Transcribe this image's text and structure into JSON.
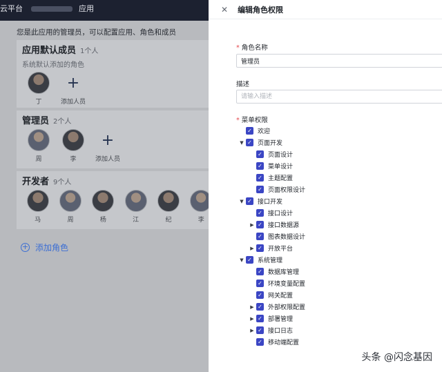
{
  "left": {
    "topbar_text": "云平台",
    "topbar_suffix": "应用",
    "intro": "您是此应用的管理员，可以配置应用、角色和成员",
    "default_members": {
      "title": "应用默认成员",
      "count": "1个人",
      "subtitle": "系统默认添加的角色",
      "members": [
        {
          "name": "丁"
        }
      ],
      "add_label": "添加人员"
    },
    "admins": {
      "title": "管理员",
      "count": "2个人",
      "members": [
        {
          "name": "周"
        },
        {
          "name": "李"
        }
      ],
      "add_label": "添加人员"
    },
    "developers": {
      "title": "开发者",
      "count": "9个人",
      "members": [
        {
          "name": "马"
        },
        {
          "name": "周"
        },
        {
          "name": "杨"
        },
        {
          "name": "江"
        },
        {
          "name": "纪"
        },
        {
          "name": "李"
        }
      ]
    },
    "add_role": "添加角色"
  },
  "drawer": {
    "title": "编辑角色权限",
    "role_name_label": "角色名称",
    "role_name_value": "管理员",
    "desc_label": "描述",
    "desc_placeholder": "请输入描述",
    "menu_label": "菜单权限",
    "tree": [
      {
        "label": "欢迎",
        "level": 0,
        "caret": "none"
      },
      {
        "label": "页面开发",
        "level": 0,
        "caret": "open"
      },
      {
        "label": "页面设计",
        "level": 1,
        "caret": "none"
      },
      {
        "label": "菜单设计",
        "level": 1,
        "caret": "none"
      },
      {
        "label": "主题配置",
        "level": 1,
        "caret": "none"
      },
      {
        "label": "页面权限设计",
        "level": 1,
        "caret": "none"
      },
      {
        "label": "接口开发",
        "level": 0,
        "caret": "open"
      },
      {
        "label": "接口设计",
        "level": 1,
        "caret": "none"
      },
      {
        "label": "接口数据源",
        "level": 1,
        "caret": "closed"
      },
      {
        "label": "图表数据设计",
        "level": 1,
        "caret": "none"
      },
      {
        "label": "开放平台",
        "level": 1,
        "caret": "closed"
      },
      {
        "label": "系统管理",
        "level": 0,
        "caret": "open"
      },
      {
        "label": "数据库管理",
        "level": 1,
        "caret": "none"
      },
      {
        "label": "环境变量配置",
        "level": 1,
        "caret": "none"
      },
      {
        "label": "网关配置",
        "level": 1,
        "caret": "none"
      },
      {
        "label": "外部权限配置",
        "level": 1,
        "caret": "closed"
      },
      {
        "label": "部署管理",
        "level": 1,
        "caret": "closed"
      },
      {
        "label": "接口日志",
        "level": 1,
        "caret": "closed"
      },
      {
        "label": "移动端配置",
        "level": 1,
        "caret": "none"
      }
    ]
  },
  "watermark": "头条 @闪念基因",
  "colors": {
    "checkbox": "#3b46c4",
    "link": "#3b6ed4",
    "required": "#e5484d"
  }
}
